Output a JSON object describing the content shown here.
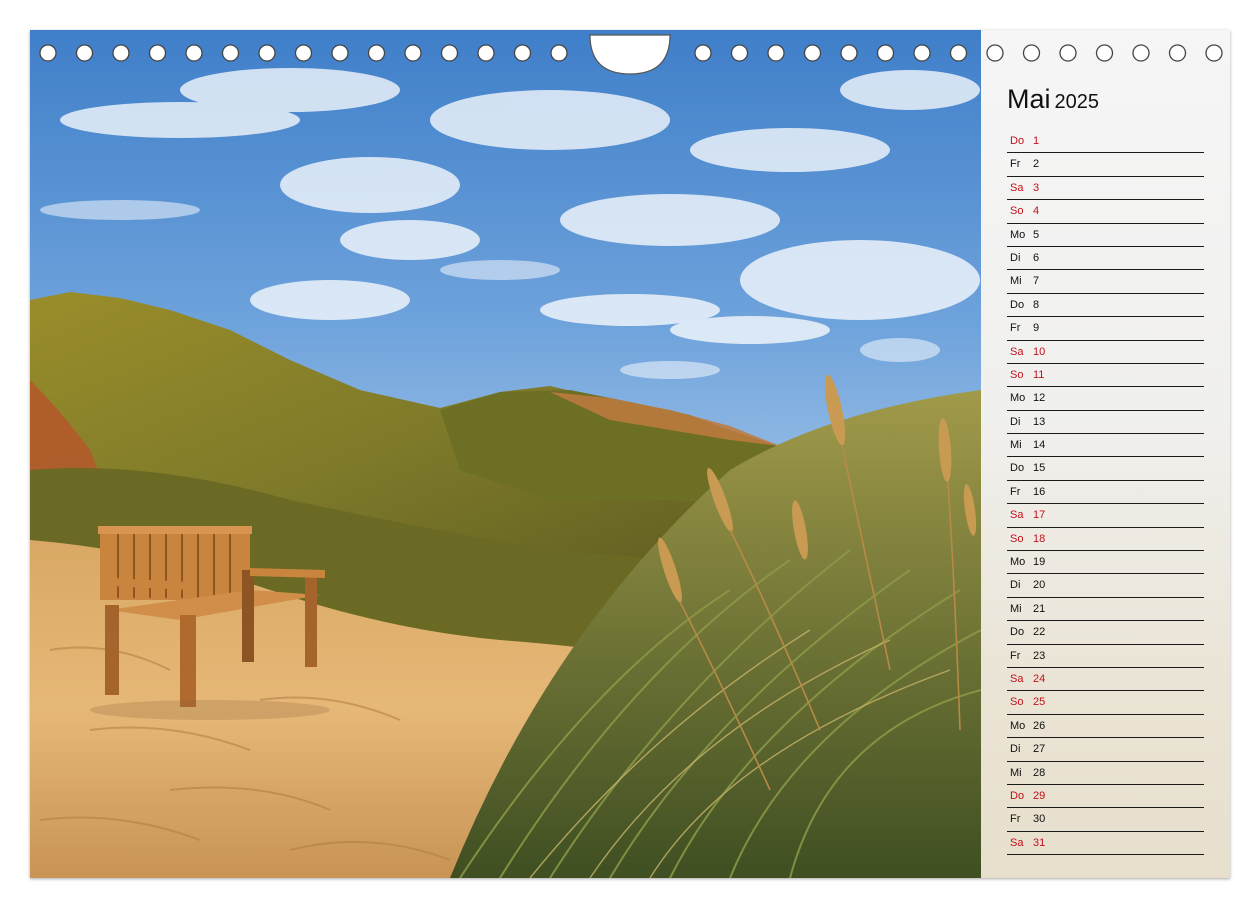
{
  "calendar": {
    "month": "Mai",
    "year": "2025",
    "days": [
      {
        "dow": "Do",
        "day": "1",
        "holiday": true
      },
      {
        "dow": "Fr",
        "day": "2",
        "holiday": false
      },
      {
        "dow": "Sa",
        "day": "3",
        "holiday": true
      },
      {
        "dow": "So",
        "day": "4",
        "holiday": true
      },
      {
        "dow": "Mo",
        "day": "5",
        "holiday": false
      },
      {
        "dow": "Di",
        "day": "6",
        "holiday": false
      },
      {
        "dow": "Mi",
        "day": "7",
        "holiday": false
      },
      {
        "dow": "Do",
        "day": "8",
        "holiday": false
      },
      {
        "dow": "Fr",
        "day": "9",
        "holiday": false
      },
      {
        "dow": "Sa",
        "day": "10",
        "holiday": true
      },
      {
        "dow": "So",
        "day": "11",
        "holiday": true
      },
      {
        "dow": "Mo",
        "day": "12",
        "holiday": false
      },
      {
        "dow": "Di",
        "day": "13",
        "holiday": false
      },
      {
        "dow": "Mi",
        "day": "14",
        "holiday": false
      },
      {
        "dow": "Do",
        "day": "15",
        "holiday": false
      },
      {
        "dow": "Fr",
        "day": "16",
        "holiday": false
      },
      {
        "dow": "Sa",
        "day": "17",
        "holiday": true
      },
      {
        "dow": "So",
        "day": "18",
        "holiday": true
      },
      {
        "dow": "Mo",
        "day": "19",
        "holiday": false
      },
      {
        "dow": "Di",
        "day": "20",
        "holiday": false
      },
      {
        "dow": "Mi",
        "day": "21",
        "holiday": false
      },
      {
        "dow": "Do",
        "day": "22",
        "holiday": false
      },
      {
        "dow": "Fr",
        "day": "23",
        "holiday": false
      },
      {
        "dow": "Sa",
        "day": "24",
        "holiday": true
      },
      {
        "dow": "So",
        "day": "25",
        "holiday": true
      },
      {
        "dow": "Mo",
        "day": "26",
        "holiday": false
      },
      {
        "dow": "Di",
        "day": "27",
        "holiday": false
      },
      {
        "dow": "Mi",
        "day": "28",
        "holiday": false
      },
      {
        "dow": "Do",
        "day": "29",
        "holiday": true
      },
      {
        "dow": "Fr",
        "day": "30",
        "holiday": false
      },
      {
        "dow": "Sa",
        "day": "31",
        "holiday": true
      }
    ]
  },
  "colors": {
    "holiday_text": "#c0121b",
    "regular_text": "#111111",
    "rule_line": "#1a1a1a"
  },
  "icons": {
    "binding_hole": "binding-hole-icon",
    "hanger_notch": "hanger-notch-icon"
  }
}
